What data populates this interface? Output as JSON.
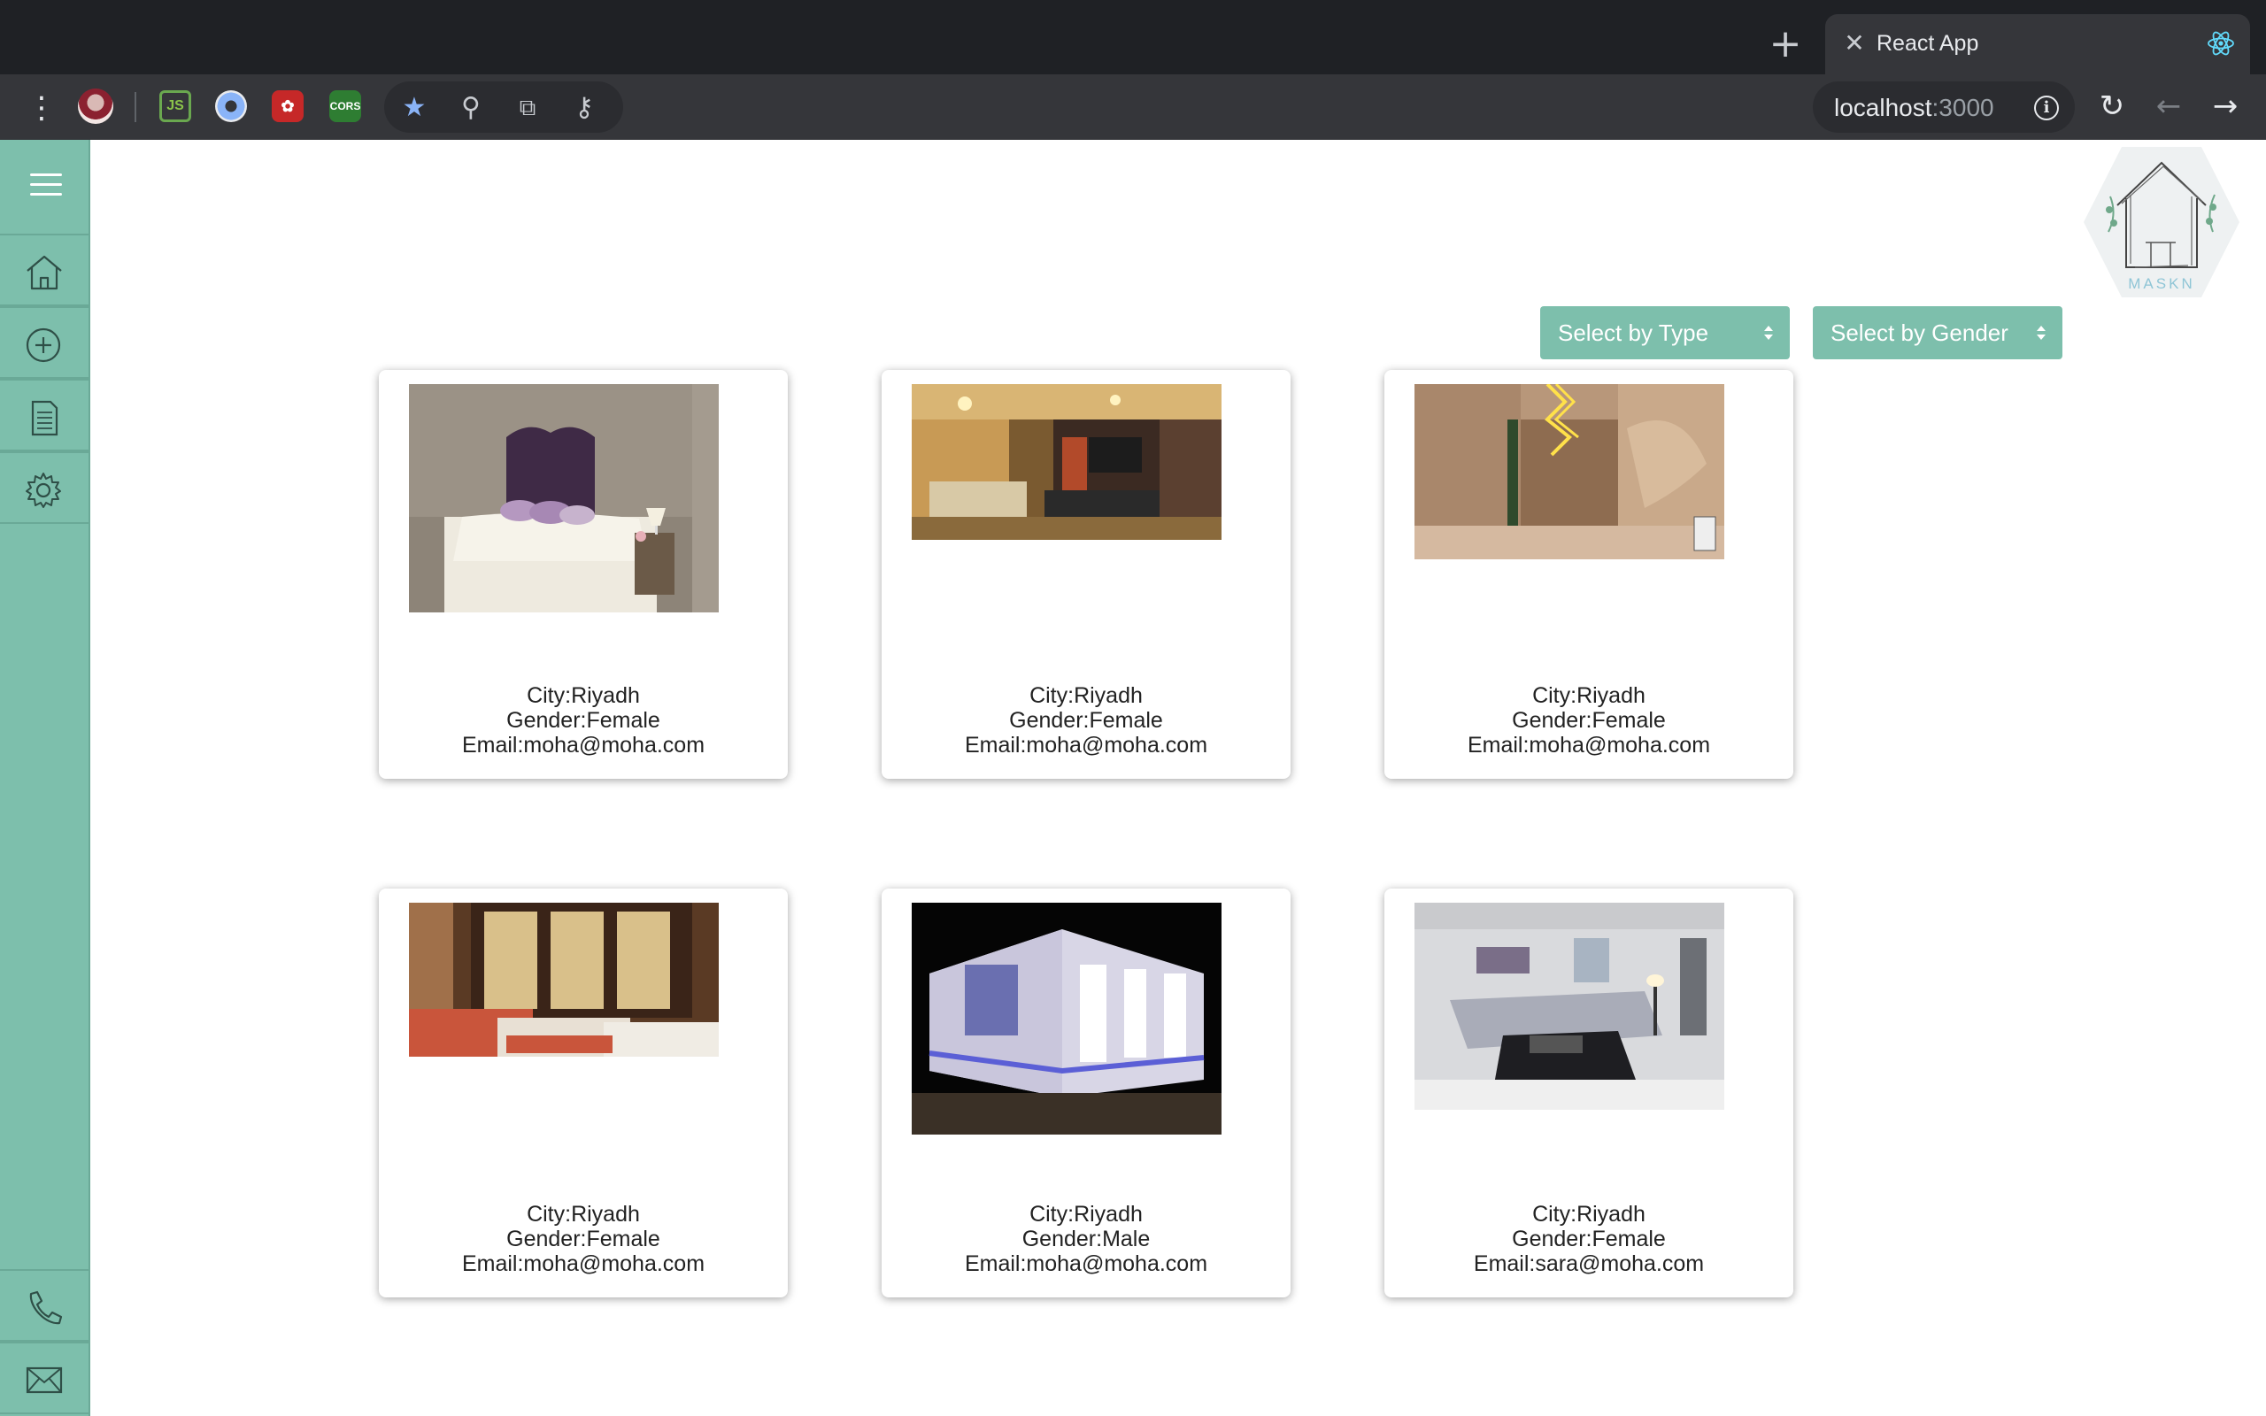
{
  "browser": {
    "tab_title": "React App",
    "url_host": "localhost",
    "url_port": ":3000",
    "icons": {
      "new_tab": "plus-icon",
      "tab_close": "close-icon",
      "favicon": "react-logo-icon",
      "menu": "kebab-menu-icon",
      "info": "info-icon",
      "reload": "reload-icon",
      "back": "back-arrow-icon",
      "forward": "forward-arrow-icon"
    },
    "extensions": [
      "nodejs-icon",
      "blue-circle-icon",
      "red-extension-icon",
      "cors-extension-icon",
      "bookmark-star-icon",
      "zoom-icon",
      "translate-icon",
      "key-icon"
    ],
    "ext_labels": {
      "node": "JS",
      "cors": "CORS"
    }
  },
  "sidebar": {
    "color": "#7dbfac",
    "items": [
      "home-icon",
      "add-circle-icon",
      "document-icon",
      "settings-gear-icon"
    ],
    "bottom_items": [
      "phone-icon",
      "mail-icon"
    ]
  },
  "logo": {
    "text": "MASKN"
  },
  "filters": {
    "type_label": "Select by Type",
    "gender_label": "Select by Gender"
  },
  "listings": [
    {
      "city": "City:Riyadh",
      "gender": "Gender:Female",
      "email": "Email:moha@moha.com",
      "image": "bedroom-purple-headboard"
    },
    {
      "city": "City:Riyadh",
      "gender": "Gender:Female",
      "email": "Email:moha@moha.com",
      "image": "living-room-warm"
    },
    {
      "city": "City:Riyadh",
      "gender": "Gender:Female",
      "email": "Email:moha@moha.com",
      "image": "hallway-lights"
    },
    {
      "city": "City:Riyadh",
      "gender": "Gender:Female",
      "email": "Email:moha@moha.com",
      "image": "twin-bedroom"
    },
    {
      "city": "City:Riyadh",
      "gender": "Gender:Male",
      "email": "Email:moha@moha.com",
      "image": "building-night"
    },
    {
      "city": "City:Riyadh",
      "gender": "Gender:Female",
      "email": "Email:sara@moha.com",
      "image": "grey-living-room"
    }
  ]
}
